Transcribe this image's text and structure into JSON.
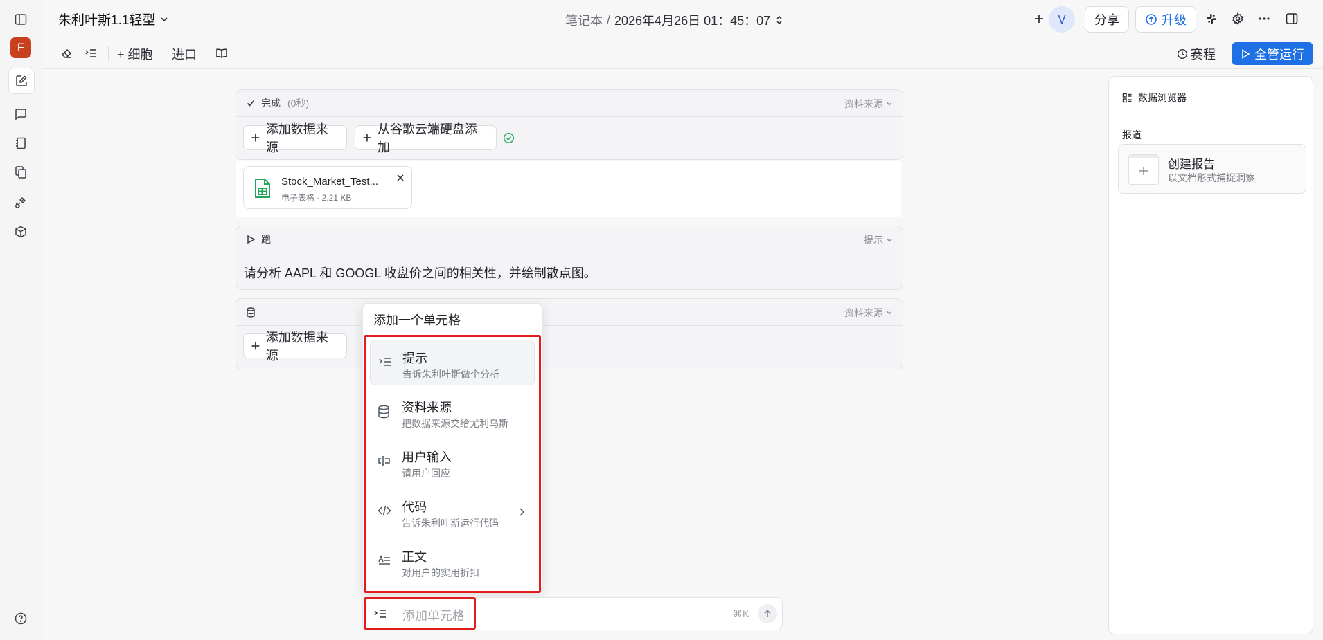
{
  "rail": {
    "avatar_letter": "F"
  },
  "header": {
    "notebook_title": "朱利叶斯1.1轻型",
    "crumb_prefix": "笔记本",
    "crumb_sep": "/",
    "crumb_date": "2026年4月26日 01：45：07",
    "v_avatar": "V",
    "share_label": "分享",
    "upgrade_label": "升级"
  },
  "toolbar": {
    "add_cell_label": "+ 细胞",
    "import_label": "进口",
    "schedule_label": "赛程",
    "run_all_label": "全管运行"
  },
  "cells": {
    "cell1": {
      "status": "完成",
      "duration": "(0秒)",
      "type_label": "资料来源",
      "add_source_label": "添加数据来源",
      "add_drive_label": "从谷歌云端硬盘添加",
      "file": {
        "name": "Stock_Market_Test...",
        "meta": "电子表格 - 2.21 KB"
      }
    },
    "cell2": {
      "status": "跑",
      "type_label": "提示",
      "prompt_text": "请分析 AAPL 和 GOOGL 收盘价之间的相关性，并绘制散点图。"
    },
    "cell3": {
      "type_label": "资料来源",
      "add_source_label": "添加数据来源"
    }
  },
  "popup": {
    "title": "添加一个单元格",
    "items": [
      {
        "title": "提示",
        "sub": "告诉朱利叶斯做个分析",
        "icon": "prompt-icon"
      },
      {
        "title": "资料来源",
        "sub": "把数据来源交给尤利乌斯",
        "icon": "database-icon"
      },
      {
        "title": "用户输入",
        "sub": "请用户回应",
        "icon": "text-input-icon"
      },
      {
        "title": "代码",
        "sub": "告诉朱利叶斯运行代码",
        "icon": "code-icon"
      },
      {
        "title": "正文",
        "sub": "对用户的实用折扣",
        "icon": "text-icon"
      }
    ]
  },
  "add_cell_bar": {
    "placeholder": "添加单元格",
    "shortcut": "⌘K"
  },
  "right_panel": {
    "title": "数据浏览器",
    "section": "报道",
    "create_title": "创建报告",
    "create_sub": "以文档形式捕捉洞察"
  },
  "colors": {
    "accent": "#1f6fe5",
    "highlight": "#e21b1b",
    "brand_f": "#c9401e",
    "success": "#2fb36b"
  }
}
